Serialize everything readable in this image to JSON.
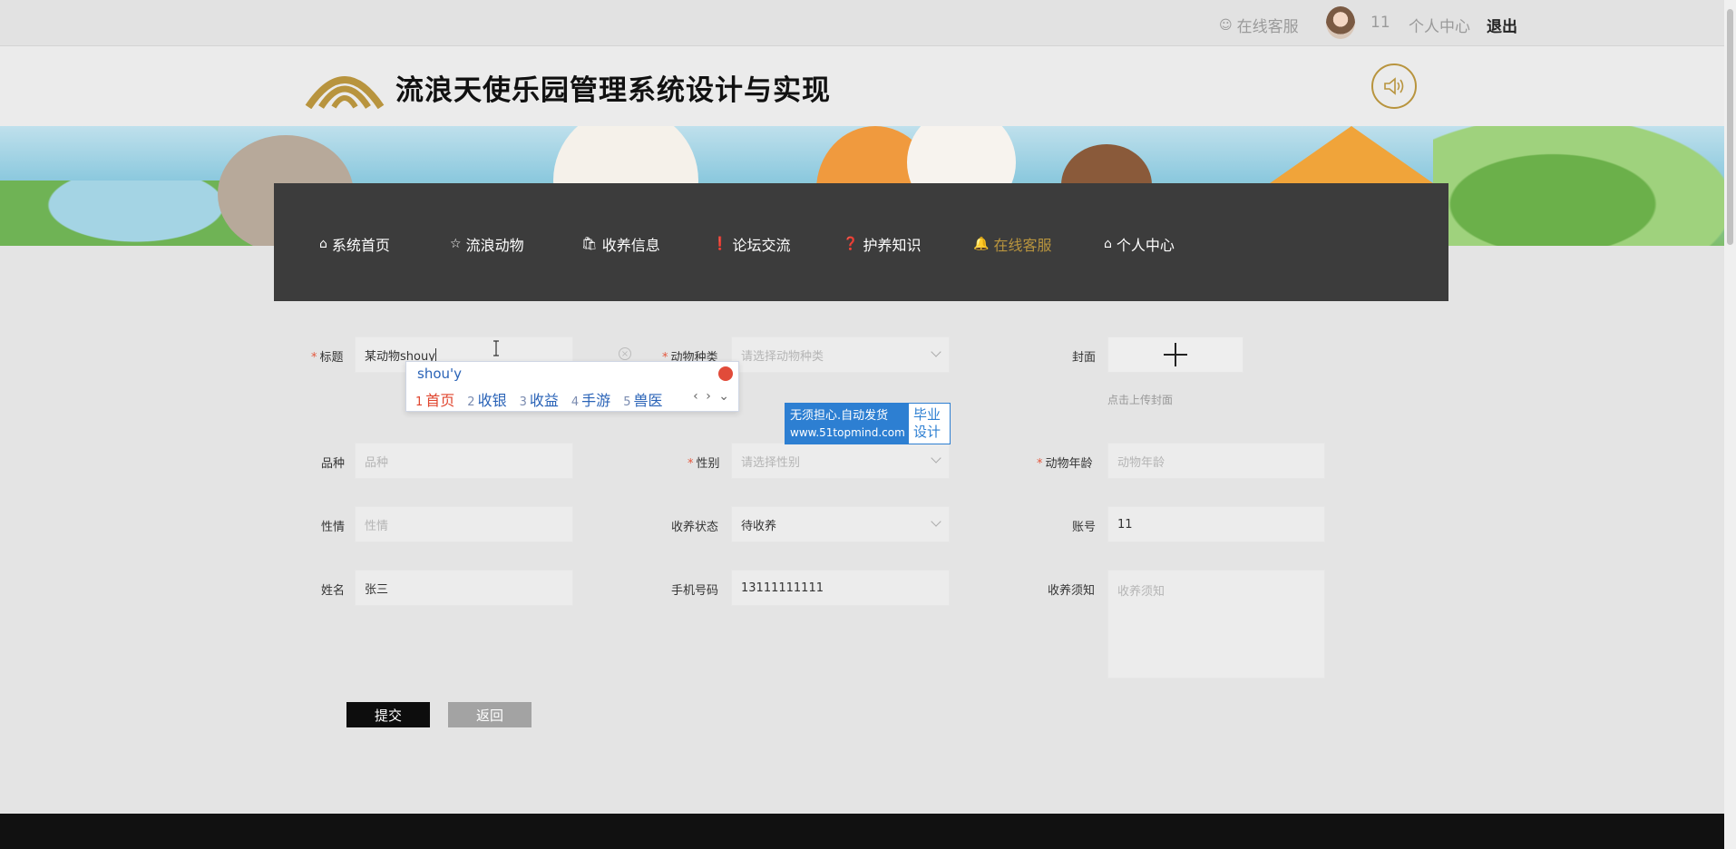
{
  "topbar": {
    "service": "在线客服",
    "user": "11",
    "center": "个人中心",
    "logout": "退出"
  },
  "header": {
    "title": "流浪天使乐园管理系统设计与实现"
  },
  "nav": {
    "items": [
      {
        "label": "系统首页",
        "icon": "home-icon"
      },
      {
        "label": "流浪动物",
        "icon": "star-icon"
      },
      {
        "label": "收养信息",
        "icon": "bag-icon"
      },
      {
        "label": "论坛交流",
        "icon": "exclamation-icon"
      },
      {
        "label": "护养知识",
        "icon": "question-icon"
      },
      {
        "label": "在线客服",
        "icon": "bell-icon"
      },
      {
        "label": "个人中心",
        "icon": "home-icon"
      }
    ],
    "active_color": "#b8943e"
  },
  "form": {
    "title": {
      "label": "标题",
      "value": "某动物shouy"
    },
    "species": {
      "label": "动物种类",
      "placeholder": "请选择动物种类"
    },
    "cover": {
      "label": "封面",
      "hint": "点击上传封面"
    },
    "breed": {
      "label": "品种",
      "placeholder": "品种"
    },
    "gender": {
      "label": "性别",
      "placeholder": "请选择性别"
    },
    "age": {
      "label": "动物年龄",
      "placeholder": "动物年龄"
    },
    "temper": {
      "label": "性情",
      "placeholder": "性情"
    },
    "adopt_status": {
      "label": "收养状态",
      "value": "待收养"
    },
    "account": {
      "label": "账号",
      "value": "11"
    },
    "name": {
      "label": "姓名",
      "value": "张三"
    },
    "phone": {
      "label": "手机号码",
      "value": "13111111111"
    },
    "notice": {
      "label": "收养须知",
      "placeholder": "收养须知"
    },
    "submit": "提交",
    "back": "返回"
  },
  "ime": {
    "input": "shou'y",
    "candidates": [
      {
        "n": "1",
        "text": "首页"
      },
      {
        "n": "2",
        "text": "收银"
      },
      {
        "n": "3",
        "text": "收益"
      },
      {
        "n": "4",
        "text": "手游"
      },
      {
        "n": "5",
        "text": "兽医"
      }
    ]
  },
  "ad": {
    "line1": "无须担心.自动发货",
    "line2": "www.51topmind.com",
    "right1": "毕业",
    "right2": "设计"
  }
}
